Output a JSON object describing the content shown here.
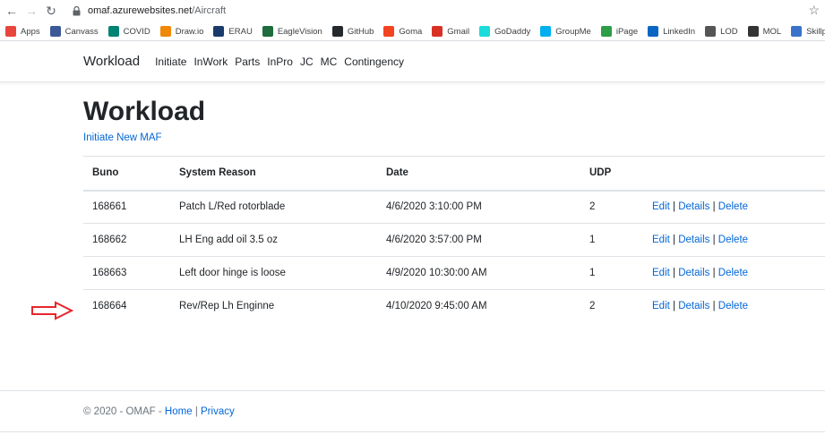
{
  "browser": {
    "url_host": "omaf.azurewebsites.net",
    "url_path": "/Aircraft",
    "bookmarks": [
      {
        "label": "Apps",
        "icon": "apps-icon",
        "color": "#e8453c"
      },
      {
        "label": "Canvass",
        "icon": "canvass-icon",
        "color": "#3b5998"
      },
      {
        "label": "COVID",
        "icon": "bing-icon",
        "color": "#008373"
      },
      {
        "label": "Draw.io",
        "icon": "drawio-icon",
        "color": "#f08705"
      },
      {
        "label": "ERAU",
        "icon": "erau-icon",
        "color": "#1a3a6c"
      },
      {
        "label": "EagleVision",
        "icon": "eaglevision-icon",
        "color": "#1e6b3c"
      },
      {
        "label": "GitHub",
        "icon": "github-icon",
        "color": "#24292e"
      },
      {
        "label": "Goma",
        "icon": "joomla-icon",
        "color": "#f44321"
      },
      {
        "label": "Gmail",
        "icon": "gmail-icon",
        "color": "#d93025"
      },
      {
        "label": "GoDaddy",
        "icon": "godaddy-icon",
        "color": "#1bdbdb"
      },
      {
        "label": "GroupMe",
        "icon": "groupme-icon",
        "color": "#00aff0"
      },
      {
        "label": "iPage",
        "icon": "ipage-icon",
        "color": "#2e9d46"
      },
      {
        "label": "LinkedIn",
        "icon": "linkedin-icon",
        "color": "#0a66c2"
      },
      {
        "label": "LOD",
        "icon": "lod-icon",
        "color": "#555555"
      },
      {
        "label": "MOL",
        "icon": "mol-icon",
        "color": "#333333"
      },
      {
        "label": "Skillpip",
        "icon": "skillpipe-icon",
        "color": "#3a73c9"
      }
    ]
  },
  "navbar": {
    "brand": "Workload",
    "links": [
      "Initiate",
      "InWork",
      "Parts",
      "InPro",
      "JC",
      "MC",
      "Contingency"
    ]
  },
  "page": {
    "title": "Workload",
    "initiate_link": "Initiate New MAF"
  },
  "table": {
    "headers": [
      "Buno",
      "System Reason",
      "Date",
      "UDP",
      ""
    ],
    "rows": [
      {
        "buno": "168661",
        "reason": "Patch L/Red rotorblade",
        "date": "4/6/2020 3:10:00 PM",
        "udp": "2"
      },
      {
        "buno": "168662",
        "reason": "LH Eng add oil 3.5 oz",
        "date": "4/6/2020 3:57:00 PM",
        "udp": "1"
      },
      {
        "buno": "168663",
        "reason": "Left door hinge is loose",
        "date": "4/9/2020 10:30:00 AM",
        "udp": "1"
      },
      {
        "buno": "168664",
        "reason": "Rev/Rep Lh Enginne",
        "date": "4/10/2020 9:45:00 AM",
        "udp": "2"
      }
    ],
    "actions": {
      "edit": "Edit",
      "details": "Details",
      "delete": "Delete",
      "separator": "|"
    }
  },
  "footer": {
    "copyright": "© 2020 - OMAF - ",
    "home": "Home",
    "separator": "|",
    "privacy": "Privacy"
  },
  "colors": {
    "link": "#0366d6",
    "annotation_arrow": "#e8262b"
  }
}
